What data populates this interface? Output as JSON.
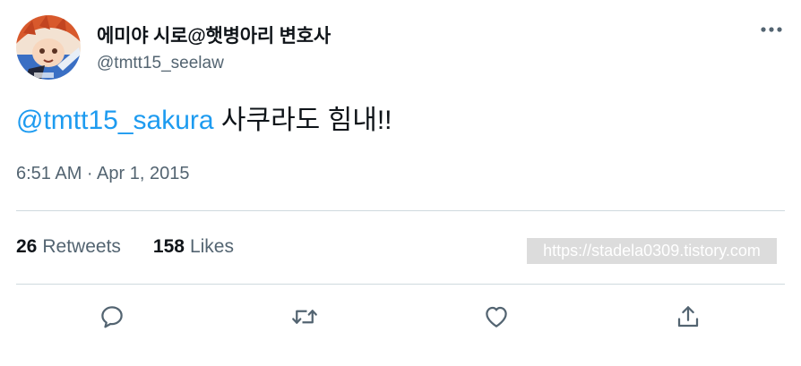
{
  "user": {
    "display_name": "에미야 시로@햇병아리 변호사",
    "handle": "@tmtt15_seelaw"
  },
  "tweet": {
    "mention": "@tmtt15_sakura",
    "text": " 사쿠라도 힘내!!",
    "timestamp": "6:51 AM · Apr 1, 2015"
  },
  "stats": {
    "retweets_count": "26",
    "retweets_label": "Retweets",
    "likes_count": "158",
    "likes_label": "Likes"
  },
  "watermark": "https://stadela0309.tistory.com",
  "icons": {
    "more": "more-horizontal-icon",
    "reply": "reply-icon",
    "retweet": "retweet-icon",
    "like": "heart-icon",
    "share": "share-icon"
  },
  "colors": {
    "accent": "#1d9bf0",
    "secondary_text": "#536471",
    "divider": "#cfd9de",
    "icon": "#536471"
  }
}
